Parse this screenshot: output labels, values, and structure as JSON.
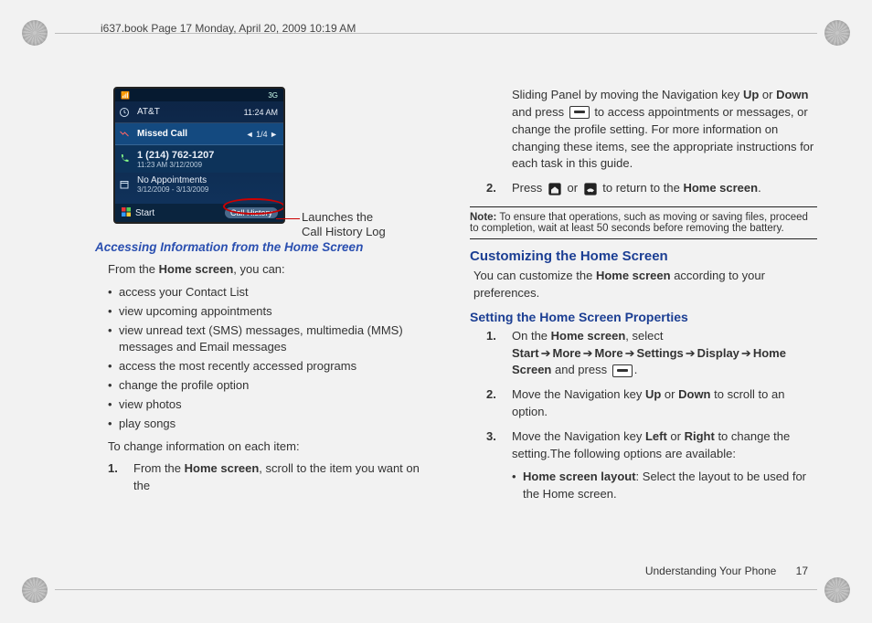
{
  "meta": {
    "top_text": "i637.book  Page 17  Monday, April 20, 2009  10:19 AM"
  },
  "phone": {
    "signal_label": "3G",
    "carrier": "AT&T",
    "clock": "11:24 AM",
    "missed_label": "Missed Call",
    "missed_count": "◄   1/4   ►",
    "call_number": "1 (214) 762-1207",
    "call_time": "11:23 AM 3/12/2009",
    "appt_label": "No Appointments",
    "appt_range": "3/12/2009 - 3/13/2009",
    "soft_left": "Start",
    "soft_right": "Call History"
  },
  "annotation": {
    "line1": "Launches the",
    "line2": "Call History Log"
  },
  "left": {
    "heading": "Accessing Information from the Home Screen",
    "intro_prefix": "From the ",
    "intro_bold": "Home screen",
    "intro_suffix": ", you can:",
    "bullets": [
      "access your Contact List",
      "view upcoming appointments",
      "view unread text (SMS) messages, multimedia (MMS) messages and Email messages",
      "access the most recently accessed programs",
      "change the profile option",
      "view photos",
      "play songs"
    ],
    "change_info": "To change information on each item:",
    "step1_prefix": "From the ",
    "step1_bold": "Home screen",
    "step1_suffix": ", scroll to the item you want on the"
  },
  "right": {
    "cont_a": "Sliding Panel by moving the Navigation key ",
    "up": "Up",
    "or": " or ",
    "down": "Down",
    "cont_b": " and press ",
    "cont_c": " to access appointments or messages, or change the profile setting. For more information on changing these items, see the appropriate instructions for each task in this guide.",
    "step2_pre": "Press ",
    "step2_mid": " or ",
    "step2_post": " to return to the ",
    "step2_bold": "Home screen",
    "step2_end": ".",
    "note_label": "Note:",
    "note_text": " To ensure that operations, such as moving or saving files, proceed to completion, wait at least 50 seconds before removing the battery.",
    "h1": "Customizing the Home Screen",
    "cust_a": "You can customize the ",
    "cust_bold": "Home screen",
    "cust_b": " according to your preferences.",
    "h2": "Setting the Home Screen Properties",
    "s1_a": "On the ",
    "s1_hs": "Home screen",
    "s1_b": ", select ",
    "s1_path": [
      "Start",
      "More",
      "More",
      "Settings",
      "Display",
      "Home Screen"
    ],
    "s1_c": " and press ",
    "s1_d": ".",
    "s2_a": "Move the Navigation key ",
    "s2_b": " to scroll to an option.",
    "s3_a": "Move the Navigation key ",
    "left_k": "Left",
    "right_k": "Right",
    "s3_b": " to change the setting.The following options are available:",
    "sub_bold": "Home screen layout",
    "sub_text": ": Select the layout to be used for the Home screen."
  },
  "footer": {
    "section": "Understanding Your Phone",
    "page": "17"
  }
}
